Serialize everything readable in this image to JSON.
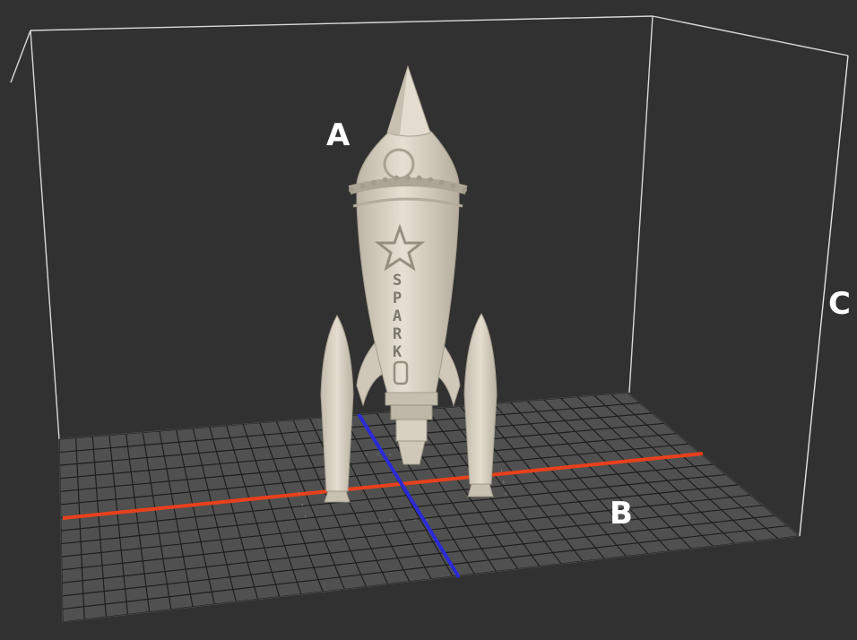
{
  "labels": {
    "a": "A",
    "b": "B",
    "c": "C"
  },
  "rocket": {
    "text_letters": [
      "S",
      "P",
      "A",
      "R",
      "K"
    ]
  },
  "colors": {
    "background": "#313131",
    "bed": "#505050",
    "grid": "#1e1e1e",
    "x_axis": "#e8401c",
    "y_axis": "#2a2ad8",
    "model": "#ddd6c7",
    "bounding_box": "#d8d8d8"
  }
}
